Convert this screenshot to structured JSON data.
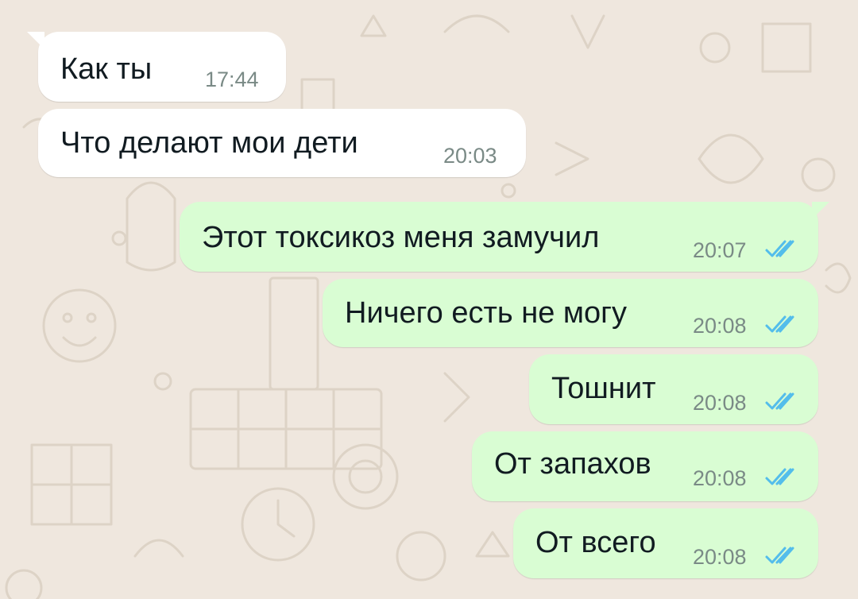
{
  "chat": {
    "colors": {
      "wallpaper": "#efe7de",
      "incoming_bubble": "#ffffff",
      "outgoing_bubble": "#d9fdd3",
      "read_ticks": "#53bdeb"
    },
    "messages": [
      {
        "text": "Как ты",
        "time": "17:44",
        "direction": "incoming"
      },
      {
        "text": "Что делают мои дети",
        "time": "20:03",
        "direction": "incoming"
      },
      {
        "text": "Этот токсикоз меня замучил",
        "time": "20:07",
        "direction": "outgoing",
        "status": "read"
      },
      {
        "text": "Ничего есть не могу",
        "time": "20:08",
        "direction": "outgoing",
        "status": "read"
      },
      {
        "text": "Тошнит",
        "time": "20:08",
        "direction": "outgoing",
        "status": "read"
      },
      {
        "text": "От запахов",
        "time": "20:08",
        "direction": "outgoing",
        "status": "read"
      },
      {
        "text": "От всего",
        "time": "20:08",
        "direction": "outgoing",
        "status": "read"
      }
    ],
    "icons": {
      "read_receipt": "double-check-icon"
    }
  }
}
